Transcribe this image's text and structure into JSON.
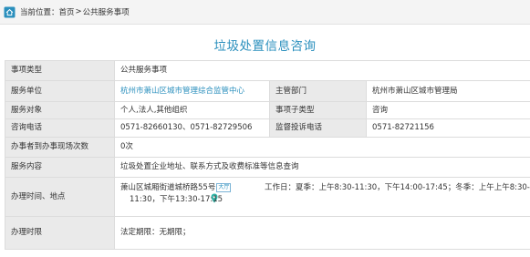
{
  "breadcrumb": {
    "label": "当前位置：",
    "home": "首页",
    "separator": ">",
    "current": "公共服务事项"
  },
  "title": "垃圾处置信息咨询",
  "rows": {
    "item_type": {
      "label": "事项类型",
      "value": "公共服务事项"
    },
    "service_unit": {
      "label": "服务单位",
      "value": "杭州市萧山区城市管理综合监管中心"
    },
    "supervisor": {
      "label": "主管部门",
      "value": "杭州市萧山区城市管理局"
    },
    "service_target": {
      "label": "服务对象",
      "value": "个人,法人,其他组织"
    },
    "sub_type": {
      "label": "事项子类型",
      "value": "咨询"
    },
    "phone": {
      "label": "咨询电话",
      "value": "0571-82660130、0571-82729506"
    },
    "complaint_phone": {
      "label": "监督投诉电话",
      "value": "0571-82721156"
    },
    "visits": {
      "label": "办事者到办事现场次数",
      "value": "0次"
    },
    "content": {
      "label": "服务内容",
      "value": "垃圾处置企业地址、联系方式及收费标准等信息查询"
    },
    "time_place": {
      "label": "办理时间、地点",
      "address": "萧山区城厢街道城桥路55号",
      "hall_badge": "大厅",
      "hours_line1": "工作日：夏季：上午8:30-11:30，下午14:00-17:45；冬季：上午上午8:30-",
      "hours_line2": "11:30，下午13:30-17:15"
    },
    "time_limit": {
      "label": "办理时限",
      "value": "法定期限：无期限；"
    }
  },
  "colors": {
    "accent": "#2a8fbd",
    "label_bg": "#eaeaea",
    "border": "#dcdcdc",
    "breadcrumb_bg": "#f4f4f4"
  },
  "icons": {
    "breadcrumb": "home-icon",
    "location": "map-pin-icon"
  }
}
